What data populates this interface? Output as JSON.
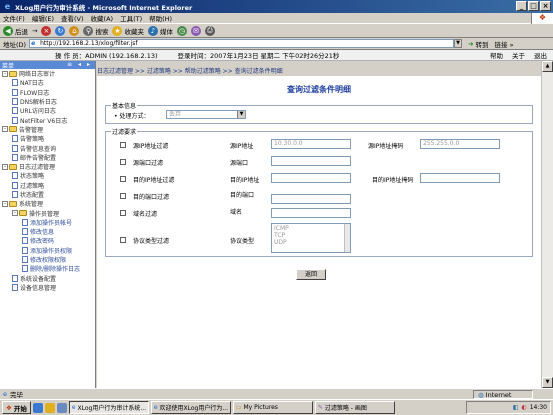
{
  "window": {
    "title": "XLog用户行为审计系统 - Microsoft Internet Explorer",
    "controls": [
      "_",
      "□",
      "×"
    ]
  },
  "menu": [
    "文件(F)",
    "编辑(E)",
    "查看(V)",
    "收藏(A)",
    "工具(T)",
    "帮助(H)"
  ],
  "toolbar": {
    "back": "后退",
    "forward": "→",
    "search": "搜索",
    "favorites": "收藏夹",
    "media": "媒体"
  },
  "address": {
    "label": "地址(D)",
    "url": "http://192.168.2.13/xlog/filter.jsf",
    "go": "转到",
    "links": "链接 »"
  },
  "app_header": {
    "operator": "操 作 员：ADMIN (192.168.2.13)",
    "login_time": "登录时间：2007年1月23日 星期二 下午02时26分21秒",
    "help": "帮助",
    "about": "关于",
    "exit": "退出"
  },
  "sidebar": {
    "header": "菜单",
    "controls": "≡ ◂ ▸",
    "items": [
      {
        "label": "网络日志审计",
        "level": 0,
        "kind": "folder",
        "toggle": "-"
      },
      {
        "label": "NAT日志",
        "level": 1,
        "kind": "doc"
      },
      {
        "label": "FLOW日志",
        "level": 1,
        "kind": "doc"
      },
      {
        "label": "DNS解析日志",
        "level": 1,
        "kind": "doc"
      },
      {
        "label": "URL访问日志",
        "level": 1,
        "kind": "doc"
      },
      {
        "label": "NetFilter V6日志",
        "level": 1,
        "kind": "doc"
      },
      {
        "label": "告警管理",
        "level": 0,
        "kind": "folder",
        "toggle": "-"
      },
      {
        "label": "告警策略",
        "level": 1,
        "kind": "doc"
      },
      {
        "label": "告警信息查询",
        "level": 1,
        "kind": "doc"
      },
      {
        "label": "邮件告警配置",
        "level": 1,
        "kind": "doc"
      },
      {
        "label": "日志过滤管理",
        "level": 0,
        "kind": "folder",
        "toggle": "-"
      },
      {
        "label": "状态策略",
        "level": 1,
        "kind": "doc"
      },
      {
        "label": "过滤策略",
        "level": 1,
        "kind": "doc"
      },
      {
        "label": "状态配置",
        "level": 1,
        "kind": "doc"
      },
      {
        "label": "系统管理",
        "level": 0,
        "kind": "folder",
        "toggle": "-"
      },
      {
        "label": "操作员管理",
        "level": 1,
        "kind": "folder",
        "toggle": "-"
      },
      {
        "label": "添加操作员帐号",
        "level": 2,
        "kind": "doc",
        "sub": true
      },
      {
        "label": "修改信息",
        "level": 2,
        "kind": "doc",
        "sub": true
      },
      {
        "label": "修改密码",
        "level": 2,
        "kind": "doc",
        "sub": true
      },
      {
        "label": "添加操作员权限",
        "level": 2,
        "kind": "doc",
        "sub": true
      },
      {
        "label": "修改权限权限",
        "level": 2,
        "kind": "doc",
        "sub": true
      },
      {
        "label": "删除/删除操作日志",
        "level": 2,
        "kind": "doc",
        "sub": true
      },
      {
        "label": "系统设备配置",
        "level": 1,
        "kind": "doc"
      },
      {
        "label": "设备信息管理",
        "level": 1,
        "kind": "doc"
      }
    ]
  },
  "breadcrumb": "日志过滤管理 >> 过滤策略 >> 帮助过滤策略 >> 查询过滤条件明细",
  "page_title": "查询过滤条件明细",
  "basic": {
    "legend": "基本信息",
    "mode_label": "• 处理方式：",
    "mode_value": "丢弃"
  },
  "filter": {
    "legend": "过滤要求",
    "rows": [
      {
        "check_label": "源IP地址过滤",
        "field_label": "源IP地址",
        "field_value": "10.30.0.0",
        "extra_label": "源IP地址掩码",
        "extra_value": "255.255.0.0"
      },
      {
        "check_label": "源端口过滤",
        "field_label": "源端口",
        "field_value": ""
      },
      {
        "check_label": "目的IP地址过滤",
        "field_label": "目的IP地址",
        "field_value": "",
        "extra_label": "目的IP地址掩码",
        "extra_value": ""
      },
      {
        "check_label": "目的端口过滤",
        "field_label": "目的端口",
        "field_value": ""
      },
      {
        "check_label": "域名过滤",
        "field_label": "域名",
        "field_value": ""
      },
      {
        "check_label": "协议类型过滤",
        "field_label": "协议类型"
      }
    ],
    "protocol_options": [
      "ICMP",
      "TCP",
      "UDP"
    ]
  },
  "back_button": "返回",
  "status": {
    "text": "完毕",
    "zone": "Internet"
  },
  "taskbar": {
    "start": "开始",
    "tasks": [
      "XLog用户行为审计系统...",
      "欢迎使用XLog用户行为...",
      "My Pictures",
      "过滤策略 - 画图"
    ],
    "clock": "14:30"
  },
  "colors": {
    "titlebar": "#0a246a",
    "accent": "#2040a0",
    "sidebar_header": "#5a8ad6",
    "folder": "#f4d35e"
  }
}
